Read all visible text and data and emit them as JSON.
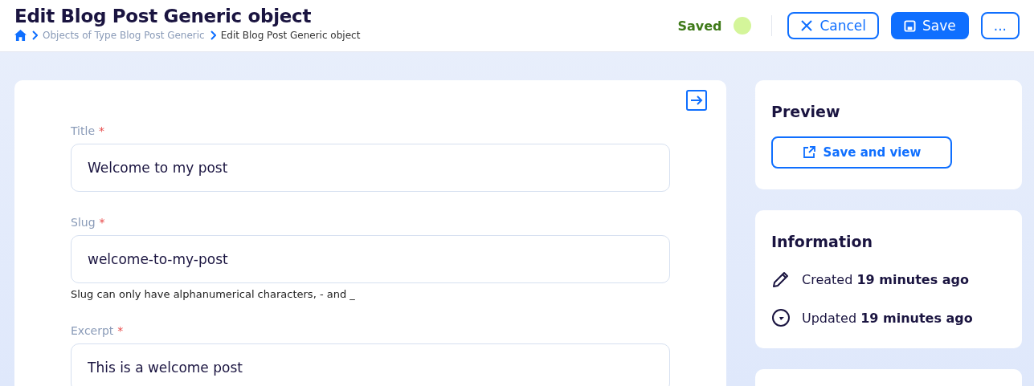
{
  "header": {
    "title": "Edit Blog Post Generic object",
    "breadcrumbs": [
      {
        "label": "Objects of Type Blog Post Generic",
        "current": false
      },
      {
        "label": "Edit Blog Post Generic object",
        "current": true
      }
    ],
    "status": "Saved",
    "actions": [
      {
        "kind": "cancel",
        "label": "Cancel"
      },
      {
        "kind": "save",
        "label": "Save"
      },
      {
        "kind": "more",
        "label": "..."
      }
    ]
  },
  "form": {
    "fields": [
      {
        "label": "Title",
        "required_mark": "*",
        "value": "Welcome to my post"
      },
      {
        "label": "Slug",
        "required_mark": "*",
        "value": "welcome-to-my-post",
        "help": "Slug can only have alphanumerical characters, - and _"
      },
      {
        "label": "Excerpt",
        "required_mark": "*",
        "value": "This is a welcome post"
      }
    ]
  },
  "preview": {
    "title": "Preview",
    "button": "Save and view"
  },
  "information": {
    "title": "Information",
    "items": [
      {
        "kind": "created",
        "text": "Created **19 minutes ago**"
      },
      {
        "kind": "updated",
        "text": "Updated **19 minutes ago**"
      }
    ]
  }
}
